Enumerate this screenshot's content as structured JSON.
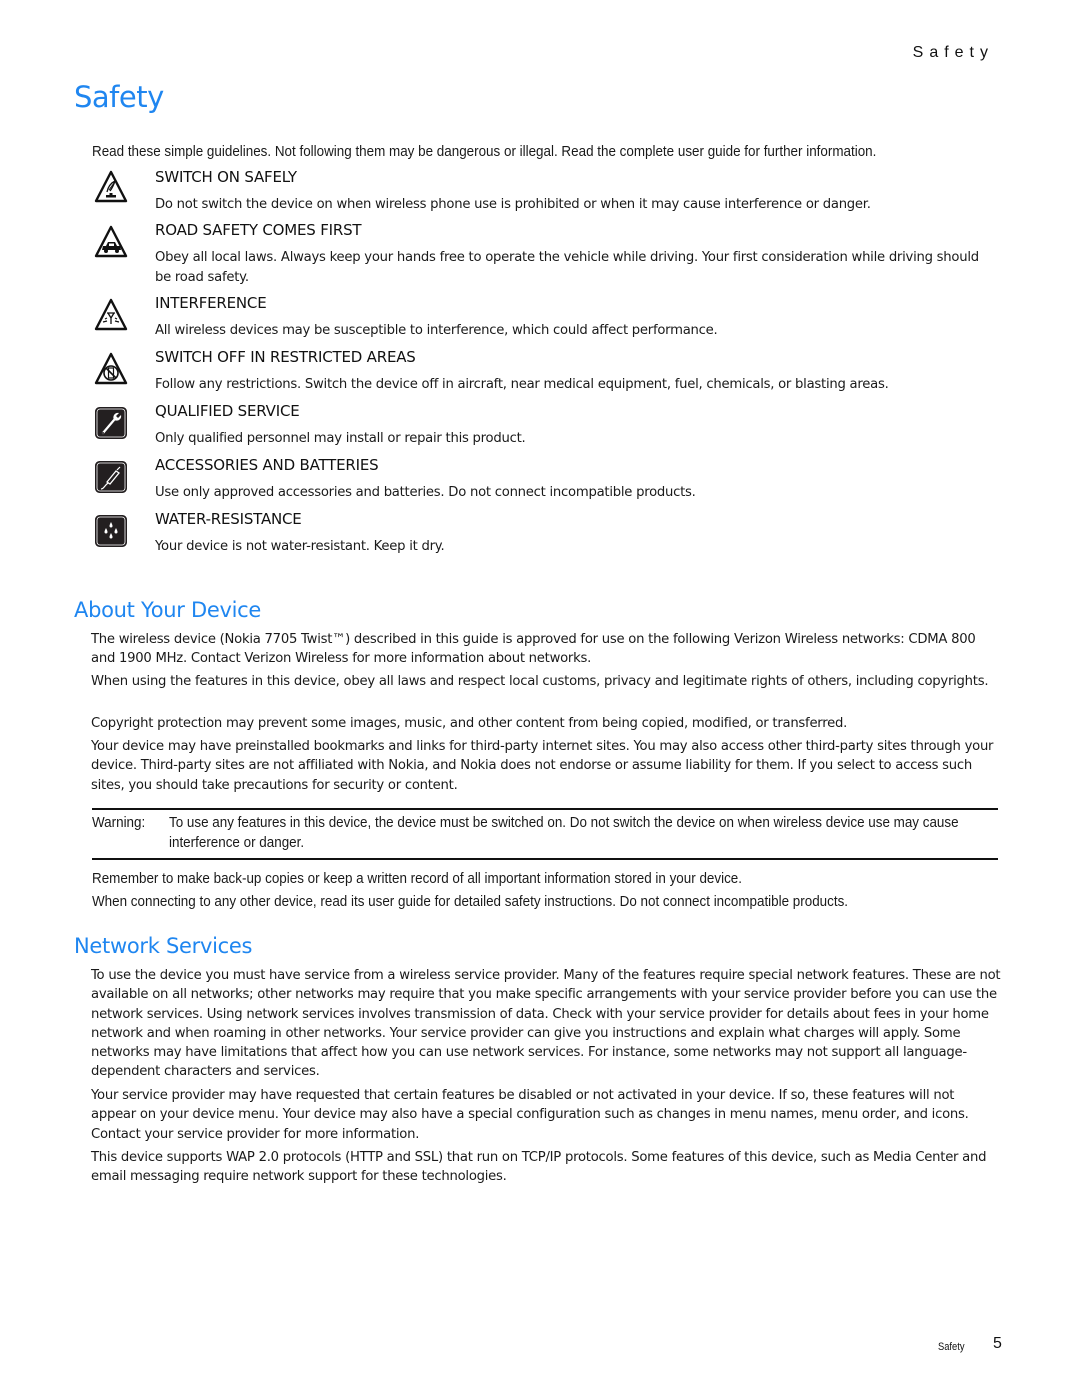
{
  "header": {
    "running_head": "Safety"
  },
  "safety": {
    "title": "Safety",
    "intro": "Read these simple guidelines. Not following them may be dangerous or illegal. Read the complete user guide for further information.",
    "items": [
      {
        "icon": "switch-on-safely-icon",
        "title": "SWITCH ON SAFELY",
        "desc": "Do not switch the device on when wireless phone use is prohibited or when it may cause interference or danger."
      },
      {
        "icon": "road-safety-icon",
        "title": "ROAD SAFETY COMES FIRST",
        "desc": "Obey all local laws. Always keep your hands free to operate the vehicle while driving. Your first consideration while driving should be road safety."
      },
      {
        "icon": "interference-icon",
        "title": "INTERFERENCE",
        "desc": "All wireless devices may be susceptible to interference, which could affect performance."
      },
      {
        "icon": "restricted-areas-icon",
        "title": "SWITCH OFF IN RESTRICTED AREAS",
        "desc": "Follow any restrictions. Switch the device off in aircraft, near medical equipment, fuel, chemicals, or blasting areas."
      },
      {
        "icon": "wrench-icon",
        "title": "QUALIFIED SERVICE",
        "desc": "Only qualified personnel may install or repair this product."
      },
      {
        "icon": "charger-plug-icon",
        "title": "ACCESSORIES AND BATTERIES",
        "desc": "Use only approved accessories and batteries. Do not connect incompatible products."
      },
      {
        "icon": "water-drops-icon",
        "title": "WATER-RESISTANCE",
        "desc": "Your device is not water-resistant. Keep it dry."
      }
    ]
  },
  "about": {
    "title": "About Your Device",
    "paragraphs": [
      "The wireless device (Nokia 7705 Twist™) described in this guide is approved for use on the following Verizon Wireless networks: CDMA 800 and 1900 MHz. Contact Verizon Wireless for more information about networks.",
      "When using the features in this device, obey all laws and respect local customs, privacy and legitimate rights of others, including copyrights.",
      "Copyright protection may prevent some images, music, and other content from being copied, modified, or transferred.",
      "Your device may have preinstalled bookmarks and links for third-party internet sites. You may also access other third-party sites through your device. Third-party sites are not affiliated with Nokia, and Nokia does not endorse or assume liability for them. If you select to access such sites, you should take precautions for security or content."
    ],
    "warning": {
      "label": "Warning:",
      "text": "To use any features in this device, the device must be switched on. Do not switch the device on when wireless device use may cause interference or danger."
    },
    "after_warning": [
      "Remember to make back-up copies or keep a written record of all important information stored in your device.",
      "When connecting to any other device, read its user guide for detailed safety instructions. Do not connect incompatible products."
    ]
  },
  "network": {
    "title": "Network Services",
    "paragraphs": [
      "To use the device you must have service from a wireless service provider. Many of the features require special network features. These are not available on all networks; other networks may require that you make specific arrangements with your service provider before you can use the network services. Using network services involves transmission of data. Check with your service provider for details about fees in your home network and when roaming in other networks. Your service provider can give you instructions and explain what charges will apply. Some networks may have limitations that affect how you can use network services. For instance, some networks may not support all language-dependent characters and services.",
      "Your service provider may have requested that certain features be disabled or not activated in your device. If so, these features will not appear on your device menu. Your device may also have a special configuration such as changes in menu names, menu order, and icons. Contact your service provider for more information.",
      "This device supports WAP 2.0 protocols (HTTP and SSL) that run on TCP/IP protocols. Some features of this device, such as Media Center and email messaging require network support for these technologies."
    ]
  },
  "footer": {
    "section": "Safety",
    "page_number": "5"
  },
  "colors": {
    "heading_blue": "#1f86f0",
    "text": "#1a1a1a"
  }
}
